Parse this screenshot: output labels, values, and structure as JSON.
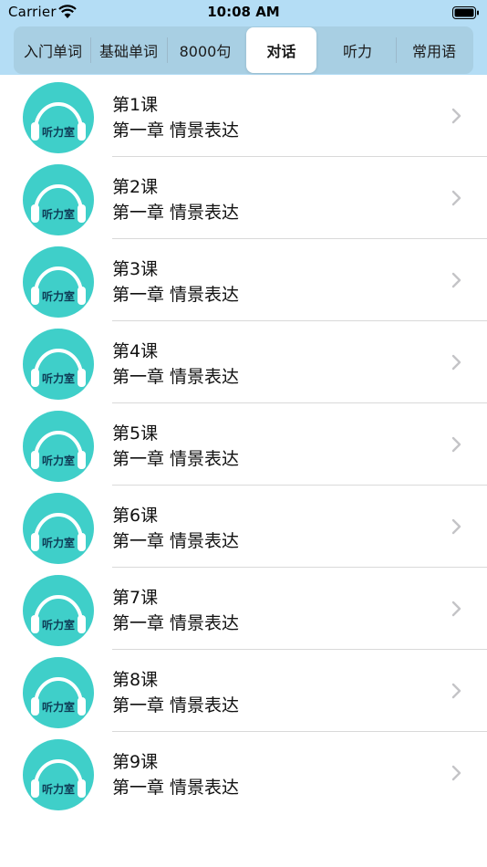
{
  "status": {
    "carrier": "Carrier",
    "time": "10:08 AM"
  },
  "tabs": [
    {
      "label": "入门单词",
      "selected": false
    },
    {
      "label": "基础单词",
      "selected": false
    },
    {
      "label": "8000句",
      "selected": false
    },
    {
      "label": "对话",
      "selected": true
    },
    {
      "label": "听力",
      "selected": false
    },
    {
      "label": "常用语",
      "selected": false
    }
  ],
  "lessons": [
    {
      "title": "第1课",
      "subtitle": "第一章 情景表达",
      "icon_label": "听力室"
    },
    {
      "title": "第2课",
      "subtitle": "第一章 情景表达",
      "icon_label": "听力室"
    },
    {
      "title": "第3课",
      "subtitle": "第一章 情景表达",
      "icon_label": "听力室"
    },
    {
      "title": "第4课",
      "subtitle": "第一章 情景表达",
      "icon_label": "听力室"
    },
    {
      "title": "第5课",
      "subtitle": "第一章 情景表达",
      "icon_label": "听力室"
    },
    {
      "title": "第6课",
      "subtitle": "第一章 情景表达",
      "icon_label": "听力室"
    },
    {
      "title": "第7课",
      "subtitle": "第一章 情景表达",
      "icon_label": "听力室"
    },
    {
      "title": "第8课",
      "subtitle": "第一章 情景表达",
      "icon_label": "听力室"
    },
    {
      "title": "第9课",
      "subtitle": "第一章 情景表达",
      "icon_label": "听力室"
    }
  ],
  "colors": {
    "header_bg": "#b4ddf5",
    "icon_bg": "#3fcfc9",
    "selected_tab": "#ffffff"
  }
}
